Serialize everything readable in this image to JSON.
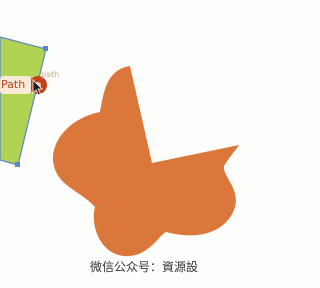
{
  "canvas": {
    "background": "#fdfdfb"
  },
  "green_panel": {
    "fill": "#b1d353",
    "stroke": "#5b86c8"
  },
  "path_chip": {
    "label": "Path",
    "background": "#f6ead6",
    "text_color": "#c0441e"
  },
  "anchor_icon": {
    "name": "path-anchor-icon",
    "fill": "#c5411c"
  },
  "cursor_icon": {
    "name": "arrow-cursor-icon"
  },
  "hint": {
    "label": "path"
  },
  "shape": {
    "fill": "#db773a"
  },
  "watermark": {
    "text": "微信公众号：資源設"
  }
}
